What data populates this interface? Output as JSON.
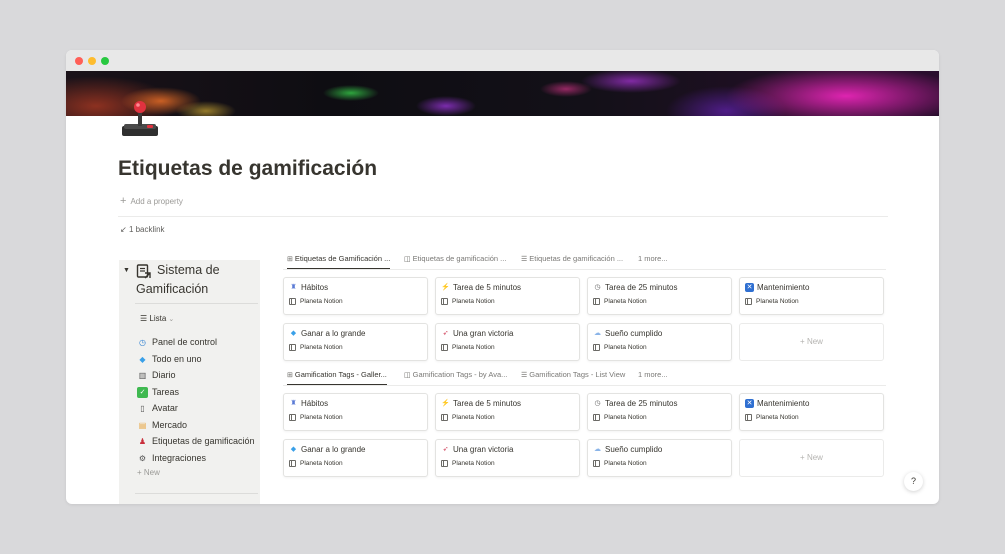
{
  "page": {
    "title": "Etiquetas de gamificación",
    "add_property": "Add a property",
    "backlink": "1 backlink"
  },
  "sidebar": {
    "title": "Sistema de Gamificación",
    "view": "Lista",
    "items": [
      {
        "label": "Panel de control",
        "icon": "dashboard-icon"
      },
      {
        "label": "Todo en uno",
        "icon": "diamond-icon"
      },
      {
        "label": "Diario",
        "icon": "journal-icon"
      },
      {
        "label": "Tareas",
        "icon": "checkbox-icon"
      },
      {
        "label": "Avatar",
        "icon": "page-icon"
      },
      {
        "label": "Mercado",
        "icon": "market-icon"
      },
      {
        "label": "Etiquetas de gamificación",
        "icon": "joystick-icon"
      },
      {
        "label": "Integraciones",
        "icon": "gear-icon"
      }
    ],
    "new_label": "+ New"
  },
  "views1": {
    "tabs": [
      "Etiquetas de Gamificación ...",
      "Etiquetas de gamificación ...",
      "Etiquetas de gamificación ..."
    ],
    "more": "1 more..."
  },
  "views2": {
    "tabs": [
      "Gamification Tags - Galler...",
      "Gamification Tags - by Ava...",
      "Gamification Tags - List View"
    ],
    "more": "1 more..."
  },
  "cards": [
    {
      "title": "Hábitos",
      "icon": "habits-icon",
      "sub": "Planeta Notion"
    },
    {
      "title": "Tarea de 5 minutos",
      "icon": "lightning-icon",
      "sub": "Planeta Notion"
    },
    {
      "title": "Tarea de 25 minutos",
      "icon": "clock-icon",
      "sub": "Planeta Notion"
    },
    {
      "title": "Mantenimiento",
      "icon": "maintenance-icon",
      "sub": "Planeta Notion"
    },
    {
      "title": "Ganar a lo grande",
      "icon": "diamond-icon",
      "sub": "Planeta Notion"
    },
    {
      "title": "Una gran victoria",
      "icon": "rocket-icon",
      "sub": "Planeta Notion"
    },
    {
      "title": "Sueño cumplido",
      "icon": "cloud-icon",
      "sub": "Planeta Notion"
    }
  ],
  "new_card_label": "+ New",
  "help_label": "?"
}
